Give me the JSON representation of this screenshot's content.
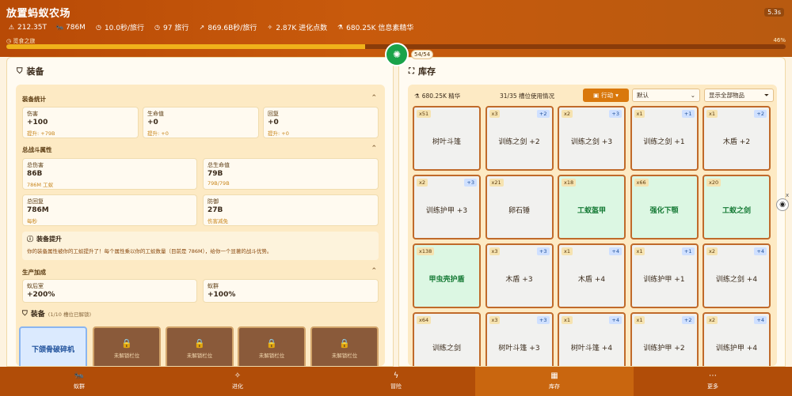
{
  "app": {
    "title": "放置蚂蚁农场",
    "timer": "5.3s"
  },
  "stats": [
    {
      "icon": "warning-icon",
      "value": "212.35T"
    },
    {
      "icon": "ant-icon",
      "value": "786M"
    },
    {
      "icon": "clock-icon",
      "value": "10.0秒/旅行"
    },
    {
      "icon": "clock-icon",
      "value": "97 旅行"
    },
    {
      "icon": "trend-icon",
      "value": "869.6B秒/旅行"
    },
    {
      "icon": "sparkle-icon",
      "value": "2.87K 进化点数"
    },
    {
      "icon": "flask-icon",
      "value": "680.25K 信息素精华"
    }
  ],
  "progress": {
    "label": "觅食之旅",
    "percent_text": "46%",
    "value": 0.46
  },
  "center": {
    "count": "54/54"
  },
  "equipment": {
    "title": "装备",
    "stats_section": "装备统计",
    "stats": [
      {
        "label": "伤害",
        "value": "+100",
        "sub": "提升: +79B"
      },
      {
        "label": "生命值",
        "value": "+0",
        "sub": "提升: +0"
      },
      {
        "label": "回复",
        "value": "+0",
        "sub": "提升: +0"
      }
    ],
    "combat_section": "总战斗属性",
    "combat": [
      {
        "label": "总伤害",
        "value": "86B",
        "sub": "786M 工蚁"
      },
      {
        "label": "总生命值",
        "value": "79B",
        "sub": "79B/79B"
      },
      {
        "label": "总回复",
        "value": "786M",
        "sub": "每秒"
      },
      {
        "label": "防御",
        "value": "27B",
        "sub": "伤害减免"
      }
    ],
    "boost_title": "装备提升",
    "boost_desc": "你的装备属性被你的工蚁提升了！每个属性乘以你的工蚁数量（目前是 786M），给你一个显著的战斗优势。",
    "production_section": "生产加成",
    "production": [
      {
        "label": "蚁后室",
        "value": "+200%"
      },
      {
        "label": "蚁群",
        "value": "+100%"
      }
    ],
    "slots_title": "装备",
    "slots_info": "(1/10 槽位已解锁)",
    "slot_filled": "下颌骨破碎机",
    "slot_locked": "未解锁栏位"
  },
  "inventory": {
    "title": "库存",
    "essence": "680.25K 精华",
    "slot_usage": "31/35 槽位使用情况",
    "action_label": "行动",
    "sort_value": "默认",
    "filter_value": "显示全部物品",
    "items": [
      {
        "qty": "x51",
        "lvl": "",
        "name": "树叶斗篷",
        "green": false
      },
      {
        "qty": "x3",
        "lvl": "+2",
        "name": "训练之剑 +2",
        "green": false
      },
      {
        "qty": "x2",
        "lvl": "+3",
        "name": "训练之剑 +3",
        "green": false
      },
      {
        "qty": "x1",
        "lvl": "+1",
        "name": "训练之剑 +1",
        "green": false
      },
      {
        "qty": "x1",
        "lvl": "+2",
        "name": "木盾 +2",
        "green": false
      },
      {
        "qty": "x2",
        "lvl": "+3",
        "name": "训练护甲 +3",
        "green": false
      },
      {
        "qty": "x21",
        "lvl": "",
        "name": "卵石锤",
        "green": false
      },
      {
        "qty": "x18",
        "lvl": "",
        "name": "工蚁盔甲",
        "green": true
      },
      {
        "qty": "x66",
        "lvl": "",
        "name": "强化下颚",
        "green": true
      },
      {
        "qty": "x20",
        "lvl": "",
        "name": "工蚁之剑",
        "green": true
      },
      {
        "qty": "x138",
        "lvl": "",
        "name": "甲虫壳护盾",
        "green": true
      },
      {
        "qty": "x3",
        "lvl": "+3",
        "name": "木盾 +3",
        "green": false
      },
      {
        "qty": "x1",
        "lvl": "+4",
        "name": "木盾 +4",
        "green": false
      },
      {
        "qty": "x1",
        "lvl": "+1",
        "name": "训练护甲 +1",
        "green": false
      },
      {
        "qty": "x2",
        "lvl": "+4",
        "name": "训练之剑 +4",
        "green": false
      },
      {
        "qty": "x64",
        "lvl": "",
        "name": "训练之剑",
        "green": false
      },
      {
        "qty": "x3",
        "lvl": "+3",
        "name": "树叶斗篷 +3",
        "green": false
      },
      {
        "qty": "x1",
        "lvl": "+4",
        "name": "树叶斗篷 +4",
        "green": false
      },
      {
        "qty": "x1",
        "lvl": "+2",
        "name": "训练护甲 +2",
        "green": false
      },
      {
        "qty": "x2",
        "lvl": "+4",
        "name": "训练护甲 +4",
        "green": false
      }
    ]
  },
  "side": {
    "close": "x"
  },
  "nav": [
    {
      "icon": "ant-icon",
      "label": "蚁群",
      "active": false
    },
    {
      "icon": "sparkle-icon",
      "label": "进化",
      "active": false
    },
    {
      "icon": "bolt-icon",
      "label": "冒险",
      "active": false
    },
    {
      "icon": "grid-icon",
      "label": "库存",
      "active": true
    },
    {
      "icon": "more-icon",
      "label": "更多",
      "active": false
    }
  ]
}
